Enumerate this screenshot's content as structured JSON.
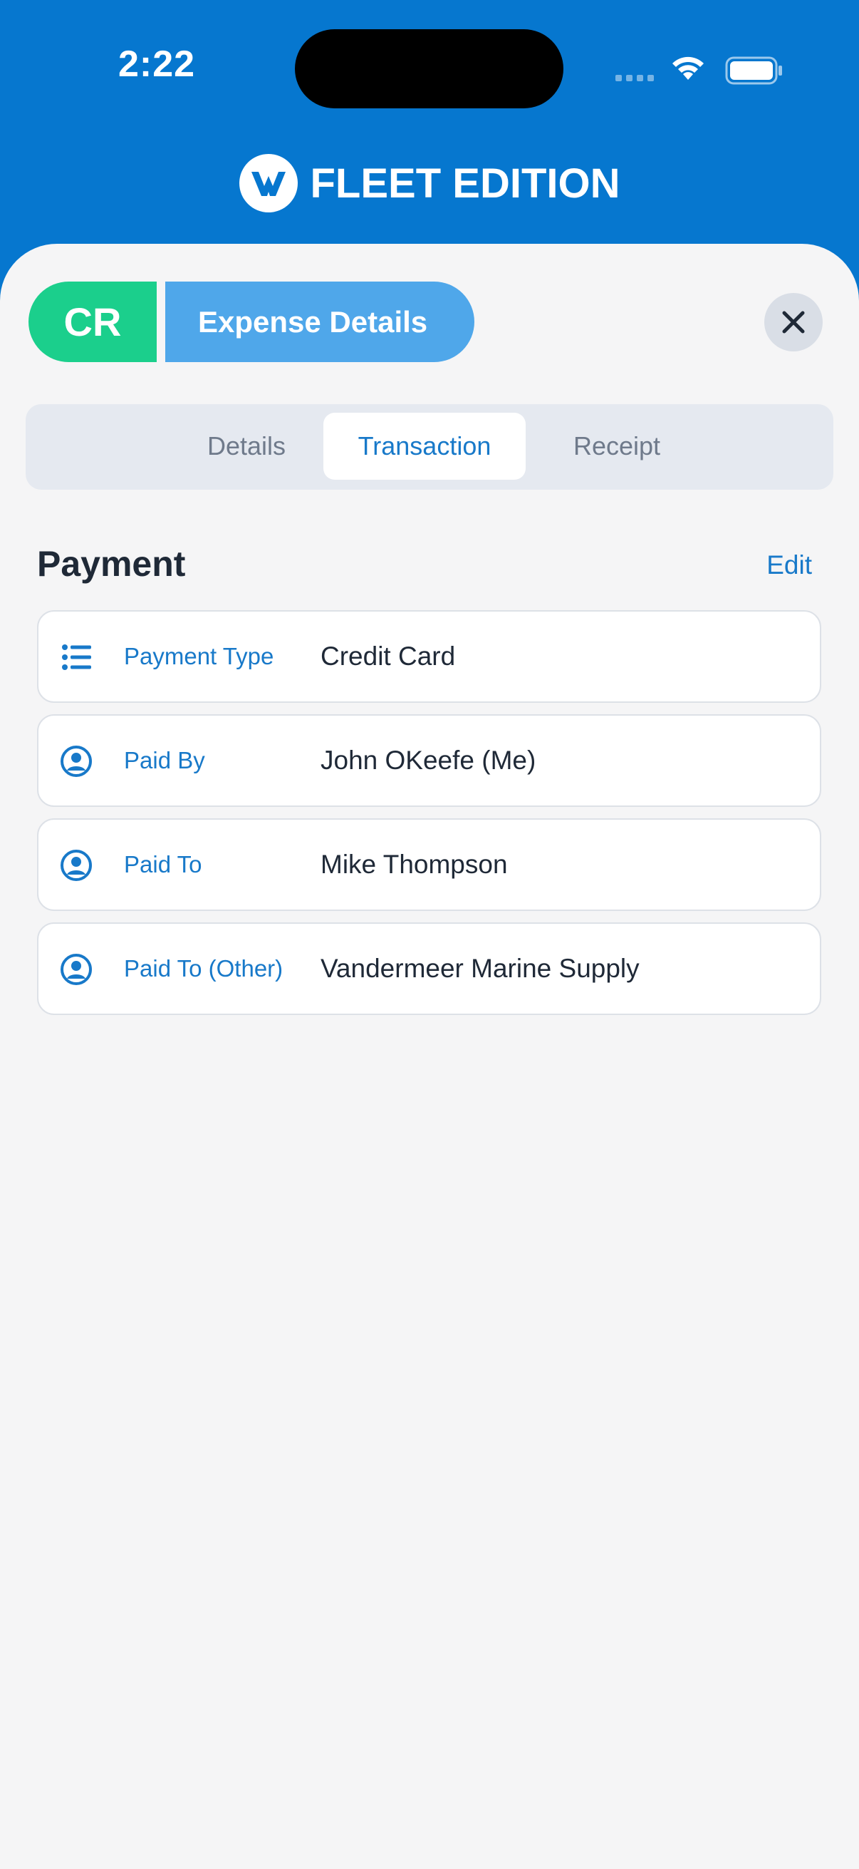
{
  "status_bar": {
    "time": "2:22"
  },
  "brand": {
    "name": "FLEET EDITION"
  },
  "header": {
    "badge": "CR",
    "title": "Expense Details",
    "close_icon": "close-icon"
  },
  "tabs": [
    {
      "label": "Details",
      "selected": false
    },
    {
      "label": "Transaction",
      "selected": true
    },
    {
      "label": "Receipt",
      "selected": false
    }
  ],
  "payment": {
    "title": "Payment",
    "edit_label": "Edit",
    "rows": [
      {
        "icon": "list-icon",
        "label": "Payment Type",
        "value": "Credit Card"
      },
      {
        "icon": "user-circle-icon",
        "label": "Paid By",
        "value": "John OKeefe (Me)"
      },
      {
        "icon": "user-circle-icon",
        "label": "Paid To",
        "value": "Mike Thompson"
      },
      {
        "icon": "user-circle-icon",
        "label": "Paid To (Other)",
        "value": "Vandermeer Marine Supply"
      }
    ]
  },
  "colors": {
    "header_blue": "#0677cf",
    "badge_green": "#1bcf8c",
    "pill_blue": "#4fa7ea",
    "accent_blue": "#1879c9"
  }
}
